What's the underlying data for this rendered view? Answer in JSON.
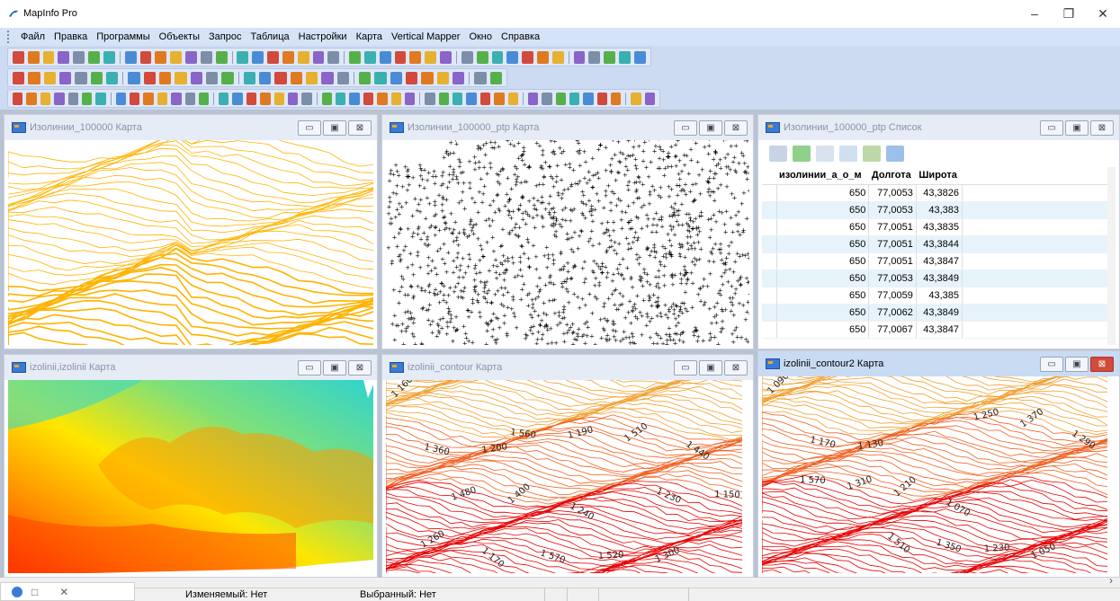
{
  "window": {
    "title": "MapInfo Pro",
    "minimize": "–",
    "restore": "❐",
    "close": "✕"
  },
  "menu": [
    "Файл",
    "Правка",
    "Программы",
    "Объекты",
    "Запрос",
    "Таблица",
    "Настройки",
    "Карта",
    "Vertical Mapper",
    "Окно",
    "Справка"
  ],
  "windows": {
    "izolinii_100000_map": {
      "title": "Изолинии_100000 Карта",
      "active": false
    },
    "izolinii_ptp_map": {
      "title": "Изолинии_100000_ptp Карта",
      "active": false
    },
    "izolinii_ptp_list": {
      "title": "Изолинии_100000_ptp Список",
      "active": false
    },
    "izolinii_grid_map": {
      "title": "izolinii,izolinii Карта",
      "active": false
    },
    "contour_map": {
      "title": "izolinii_contour Карта",
      "active": false,
      "labels": [
        "1 160",
        "1 200",
        "1 240",
        "1 300",
        "1 360",
        "1 400",
        "1 520",
        "1 440",
        "1 480",
        "1 570",
        "1 510",
        "1 150",
        "1 170",
        "1 190",
        "1 230",
        "1 260",
        "1 560"
      ]
    },
    "contour2_map": {
      "title": "izolinii_contour2 Карта",
      "active": true,
      "labels": [
        "1 090",
        "1 130",
        "1 070",
        "1 050",
        "1 170",
        "1 210",
        "1 230",
        "1 290",
        "1 310",
        "1 350",
        "1 370",
        "1 570",
        "1 510",
        "1 250"
      ]
    }
  },
  "child_buttons": {
    "min": "▭",
    "max": "▣",
    "close": "⊠"
  },
  "list": {
    "columns": [
      "изолинии_а_о_м",
      "Долгота",
      "Широта"
    ],
    "rows": [
      [
        "650",
        "77,0053",
        "43,3826"
      ],
      [
        "650",
        "77,0053",
        "43,383"
      ],
      [
        "650",
        "77,0051",
        "43,3835"
      ],
      [
        "650",
        "77,0051",
        "43,3844"
      ],
      [
        "650",
        "77,0051",
        "43,3847"
      ],
      [
        "650",
        "77,0053",
        "43,3849"
      ],
      [
        "650",
        "77,0059",
        "43,385"
      ],
      [
        "650",
        "77,0062",
        "43,3849"
      ],
      [
        "650",
        "77,0067",
        "43,3847"
      ]
    ]
  },
  "status": {
    "editable": "Изменяемый: Нет",
    "selected": "Выбранный: Нет"
  },
  "taskbar": {
    "square": "□",
    "close": "✕"
  },
  "scroll_arrow": "›",
  "colors": {
    "contour_orange": "#ffb300",
    "contour_red": "#e60000",
    "menubar": "#d6e2f6",
    "toolbar": "#ccdaf2",
    "mdi_bg": "#b9c3d4"
  }
}
